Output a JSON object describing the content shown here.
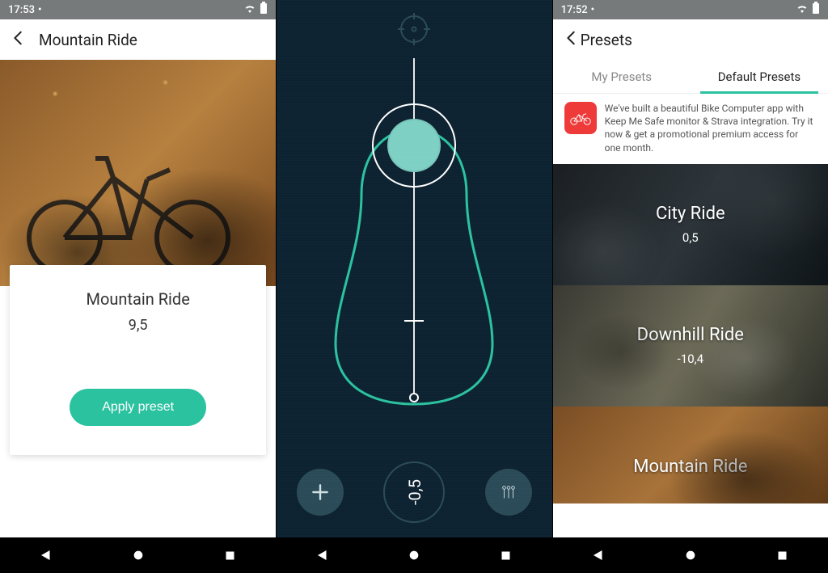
{
  "screen1": {
    "time": "17:53",
    "header_title": "Mountain Ride",
    "card_title": "Mountain Ride",
    "card_value": "9,5",
    "apply_label": "Apply preset"
  },
  "screen2": {
    "center_value": "-0,5"
  },
  "screen3": {
    "time": "17:52",
    "header_title": "Presets",
    "tabs": {
      "my": "My Presets",
      "default": "Default Presets"
    },
    "promo_text": "We've built a beautiful Bike Computer app with Keep Me Safe monitor & Strava integration. Try it now & get a promotional premium access for one month.",
    "presets": [
      {
        "name": "City Ride",
        "value": "0,5"
      },
      {
        "name": "Downhill Ride",
        "value": "-10,4"
      },
      {
        "name": "Mountain Ride",
        "value": ""
      }
    ]
  },
  "colors": {
    "accent": "#2bc2a0",
    "dark_bg": "#0c2230"
  }
}
